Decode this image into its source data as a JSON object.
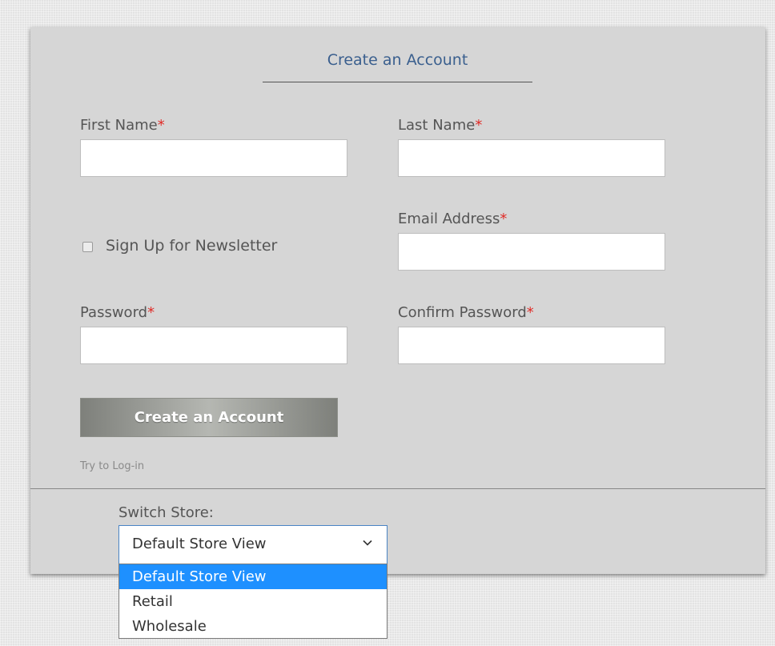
{
  "form": {
    "title": "Create an Account",
    "first_name_label": "First Name",
    "last_name_label": "Last Name",
    "email_label": "Email Address",
    "password_label": "Password",
    "confirm_password_label": "Confirm Password",
    "required_marker": "*",
    "first_name_value": "",
    "last_name_value": "",
    "email_value": "",
    "password_value": "",
    "confirm_password_value": "",
    "newsletter_label": "Sign Up for Newsletter",
    "newsletter_checked": false,
    "submit_label": "Create an Account",
    "login_link": "Try to Log-in"
  },
  "store_switcher": {
    "label": "Switch Store:",
    "selected": "Default Store View",
    "options": [
      "Default Store View",
      "Retail",
      "Wholesale"
    ],
    "highlighted_index": 0
  },
  "colors": {
    "title": "#3a5f8e",
    "required": "#e02b27",
    "highlight": "#1e90ff",
    "select_border": "#4a84c4"
  },
  "icons": {
    "select_toggle": "chevron-down-icon"
  }
}
